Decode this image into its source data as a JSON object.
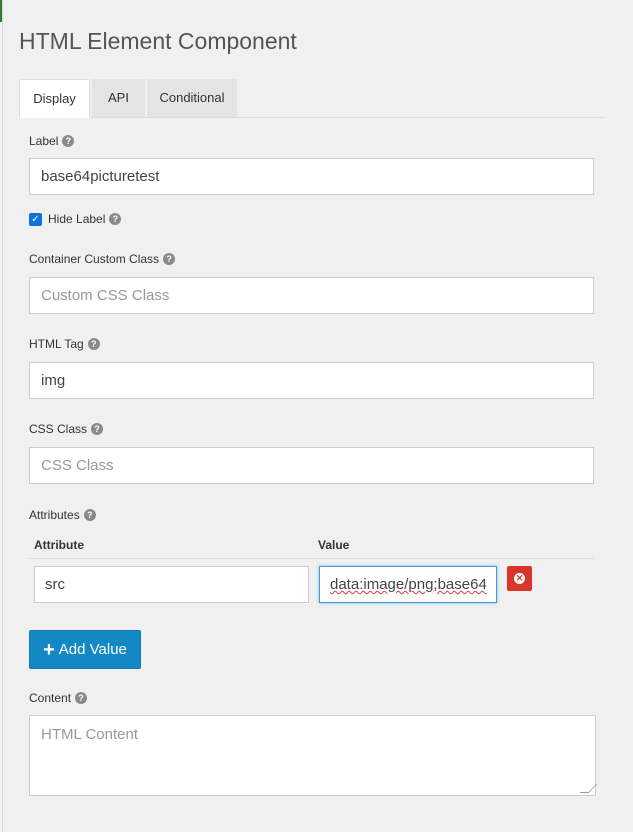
{
  "title": "HTML Element Component",
  "tabs": [
    {
      "label": "Display",
      "active": true
    },
    {
      "label": "API",
      "active": false
    },
    {
      "label": "Conditional",
      "active": false
    }
  ],
  "help_icon": "question-circle-icon",
  "fields": {
    "label": {
      "label": "Label",
      "value": "base64picturetest"
    },
    "hide_label": {
      "label": "Hide Label",
      "checked": true
    },
    "container_class": {
      "label": "Container Custom Class",
      "placeholder": "Custom CSS Class"
    },
    "html_tag": {
      "label": "HTML Tag",
      "value": "img"
    },
    "css_class": {
      "label": "CSS Class",
      "placeholder": "CSS Class"
    },
    "attributes": {
      "label": "Attributes",
      "columns": [
        "Attribute",
        "Value"
      ],
      "rows": [
        {
          "attribute": "src",
          "value": "data:image/png;base64"
        }
      ],
      "add_button": "Add Value"
    },
    "content": {
      "label": "Content",
      "placeholder": "HTML Content"
    }
  },
  "colors": {
    "accent": "#1289c4",
    "danger": "#d9362b",
    "checkbox": "#0b74d9"
  }
}
